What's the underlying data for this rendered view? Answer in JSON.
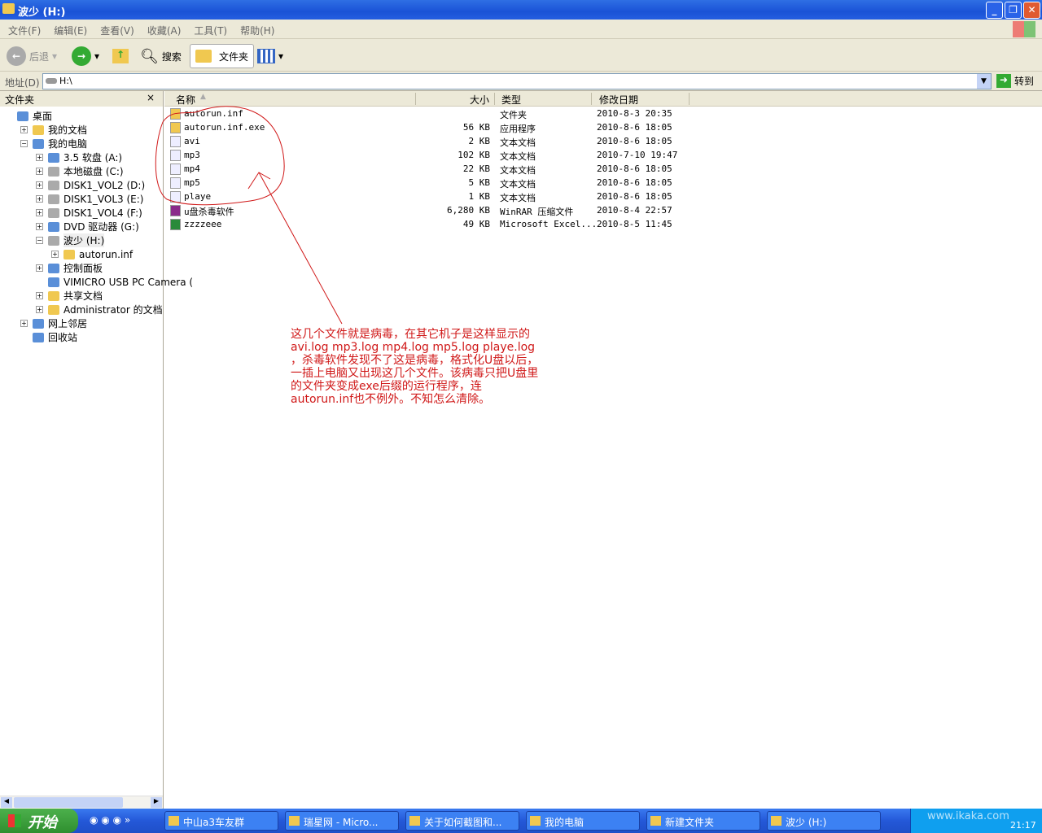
{
  "window": {
    "title": "波少 (H:)"
  },
  "menu": [
    "文件(F)",
    "编辑(E)",
    "查看(V)",
    "收藏(A)",
    "工具(T)",
    "帮助(H)"
  ],
  "toolbar": {
    "back": "后退",
    "search": "搜索",
    "folders": "文件夹"
  },
  "address": {
    "label": "地址(D)",
    "value": "H:\\",
    "go": "转到"
  },
  "left_pane": {
    "title": "文件夹",
    "close": "×",
    "tree": [
      {
        "label": "桌面",
        "level": 0,
        "exp": ""
      },
      {
        "label": "我的文档",
        "level": 1,
        "exp": "+"
      },
      {
        "label": "我的电脑",
        "level": 1,
        "exp": "-"
      },
      {
        "label": "3.5 软盘 (A:)",
        "level": 2,
        "exp": "+"
      },
      {
        "label": "本地磁盘 (C:)",
        "level": 2,
        "exp": "+"
      },
      {
        "label": "DISK1_VOL2 (D:)",
        "level": 2,
        "exp": "+"
      },
      {
        "label": "DISK1_VOL3 (E:)",
        "level": 2,
        "exp": "+"
      },
      {
        "label": "DISK1_VOL4 (F:)",
        "level": 2,
        "exp": "+"
      },
      {
        "label": "DVD 驱动器 (G:)",
        "level": 2,
        "exp": "+"
      },
      {
        "label": "波少 (H:)",
        "level": 2,
        "exp": "-",
        "selected": true
      },
      {
        "label": "autorun.inf",
        "level": 3,
        "exp": "+"
      },
      {
        "label": "控制面板",
        "level": 2,
        "exp": "+"
      },
      {
        "label": "VIMICRO USB PC Camera (",
        "level": 2,
        "exp": ""
      },
      {
        "label": "共享文档",
        "level": 2,
        "exp": "+"
      },
      {
        "label": "Administrator 的文档",
        "level": 2,
        "exp": "+"
      },
      {
        "label": "网上邻居",
        "level": 1,
        "exp": "+"
      },
      {
        "label": "回收站",
        "level": 1,
        "exp": ""
      }
    ]
  },
  "columns": {
    "name": "名称",
    "size": "大小",
    "type": "类型",
    "date": "修改日期"
  },
  "files": [
    {
      "name": "autorun.inf",
      "size": "",
      "type": "文件夹",
      "date": "2010-8-3 20:35",
      "icon": "folder"
    },
    {
      "name": "autorun.inf.exe",
      "size": "56 KB",
      "type": "应用程序",
      "date": "2010-8-6 18:05",
      "icon": "folder"
    },
    {
      "name": "avi",
      "size": "2 KB",
      "type": "文本文档",
      "date": "2010-8-6 18:05",
      "icon": "text"
    },
    {
      "name": "mp3",
      "size": "102 KB",
      "type": "文本文档",
      "date": "2010-7-10 19:47",
      "icon": "text"
    },
    {
      "name": "mp4",
      "size": "22 KB",
      "type": "文本文档",
      "date": "2010-8-6 18:05",
      "icon": "text"
    },
    {
      "name": "mp5",
      "size": "5 KB",
      "type": "文本文档",
      "date": "2010-8-6 18:05",
      "icon": "text"
    },
    {
      "name": "playe",
      "size": "1 KB",
      "type": "文本文档",
      "date": "2010-8-6 18:05",
      "icon": "text"
    },
    {
      "name": "u盘杀毒软件",
      "size": "6,280 KB",
      "type": "WinRAR 压缩文件",
      "date": "2010-8-4 22:57",
      "icon": "rar"
    },
    {
      "name": "zzzzeee",
      "size": "49 KB",
      "type": "Microsoft Excel...",
      "date": "2010-8-5 11:45",
      "icon": "excel"
    }
  ],
  "annotation": {
    "color": "#d01818",
    "text": "这几个文件就是病毒，在其它机子是这样显示的avi.log  mp3.log  mp4.log  mp5.log  playe.log ，杀毒软件发现不了这是病毒，格式化U盘以后，一插上电脑又出现这几个文件。该病毒只把U盘里的文件夹变成exe后缀的运行程序，连autorun.inf也不例外。不知怎么清除。"
  },
  "taskbar": {
    "start": "开始",
    "tasks": [
      "中山a3车友群",
      "瑞星网 - Micro...",
      "关于如何截图和...",
      "我的电脑",
      "新建文件夹",
      "波少 (H:)"
    ],
    "clock": "21:17",
    "watermark": "www.ikaka.com"
  }
}
